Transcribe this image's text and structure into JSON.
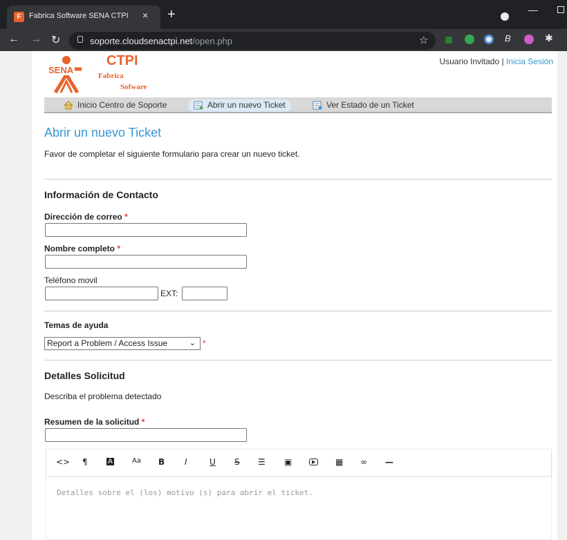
{
  "browser": {
    "tab_title": "Fabrica Software SENA CTPI",
    "tab_close": "×",
    "new_tab": "+",
    "url_host": "soporte.cloudsenactpi.net",
    "url_path": "/open.php"
  },
  "logo": {
    "sena": "SENA",
    "ctpi": "CTPI",
    "fabrica": "Fabrica",
    "sofware": "Sofware"
  },
  "user": {
    "guest": "Usuario Invitado",
    "separator": " | ",
    "login": "Inicia Sesión"
  },
  "nav": {
    "home": "Inicio Centro de Soporte",
    "new_ticket": "Abrir un nuevo Ticket",
    "status": "Ver Estado de un Ticket"
  },
  "page": {
    "title": "Abrir un nuevo Ticket",
    "intro": "Favor de completar el siguiente formulario para crear un nuevo ticket."
  },
  "contact": {
    "heading": "Información de Contacto",
    "email_label": "Dirección de correo",
    "name_label": "Nombre completo",
    "phone_label": "Teléfono movil",
    "ext_label": "EXT:",
    "required_mark": "*"
  },
  "help": {
    "heading": "Temas de ayuda",
    "selected": "Report a Problem / Access Issue"
  },
  "details": {
    "heading": "Detalles Solicitud",
    "description": "Describa el problema detectado",
    "summary_label": "Resumen de la solicitud",
    "editor_placeholder": "Detalles sobre el (los) motivo (s) para abrir el ticket."
  },
  "editor_toolbar": [
    {
      "icon": "code-view-icon",
      "glyph": "<>"
    },
    {
      "icon": "paragraph-icon",
      "glyph": "¶"
    },
    {
      "icon": "text-color-icon",
      "glyph": "A"
    },
    {
      "icon": "font-size-icon",
      "glyph": "Aa"
    },
    {
      "icon": "bold-icon",
      "glyph": "B"
    },
    {
      "icon": "italic-icon",
      "glyph": "I"
    },
    {
      "icon": "underline-icon",
      "glyph": "U"
    },
    {
      "icon": "strikethrough-icon",
      "glyph": "S"
    },
    {
      "icon": "list-icon",
      "glyph": "☰"
    },
    {
      "icon": "image-icon",
      "glyph": "▣"
    },
    {
      "icon": "video-icon",
      "glyph": "▶"
    },
    {
      "icon": "table-icon",
      "glyph": "▦"
    },
    {
      "icon": "link-icon",
      "glyph": "∞"
    },
    {
      "icon": "horizontal-rule-icon",
      "glyph": "—"
    }
  ],
  "colors": {
    "accent": "#3a95d5",
    "required": "#ee3333",
    "sena_orange": "#e8632b"
  }
}
